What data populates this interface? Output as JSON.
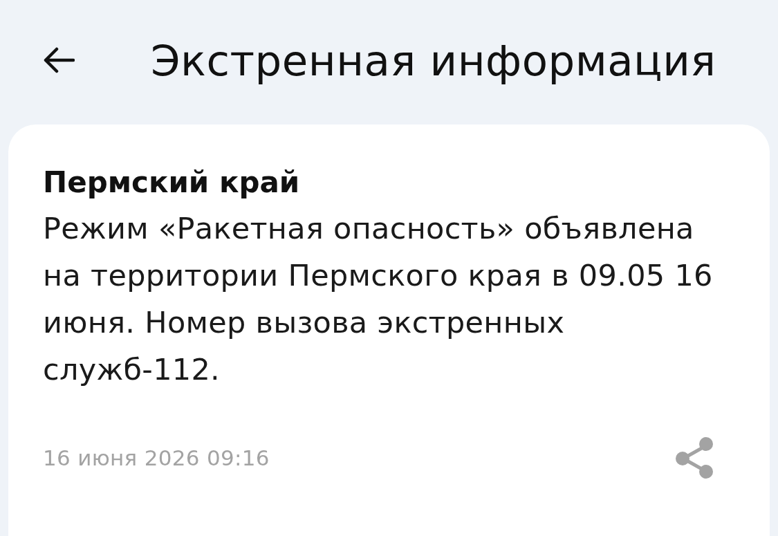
{
  "header": {
    "title": "Экстренная информация"
  },
  "alert": {
    "region": "Пермский край",
    "message": "Режим «Ракетная опасность» объявлена на территории Пермского края в 09.05 16 июня. Номер вызова экстренных служб-112.",
    "timestamp": "16 июня 2026 09:16"
  }
}
